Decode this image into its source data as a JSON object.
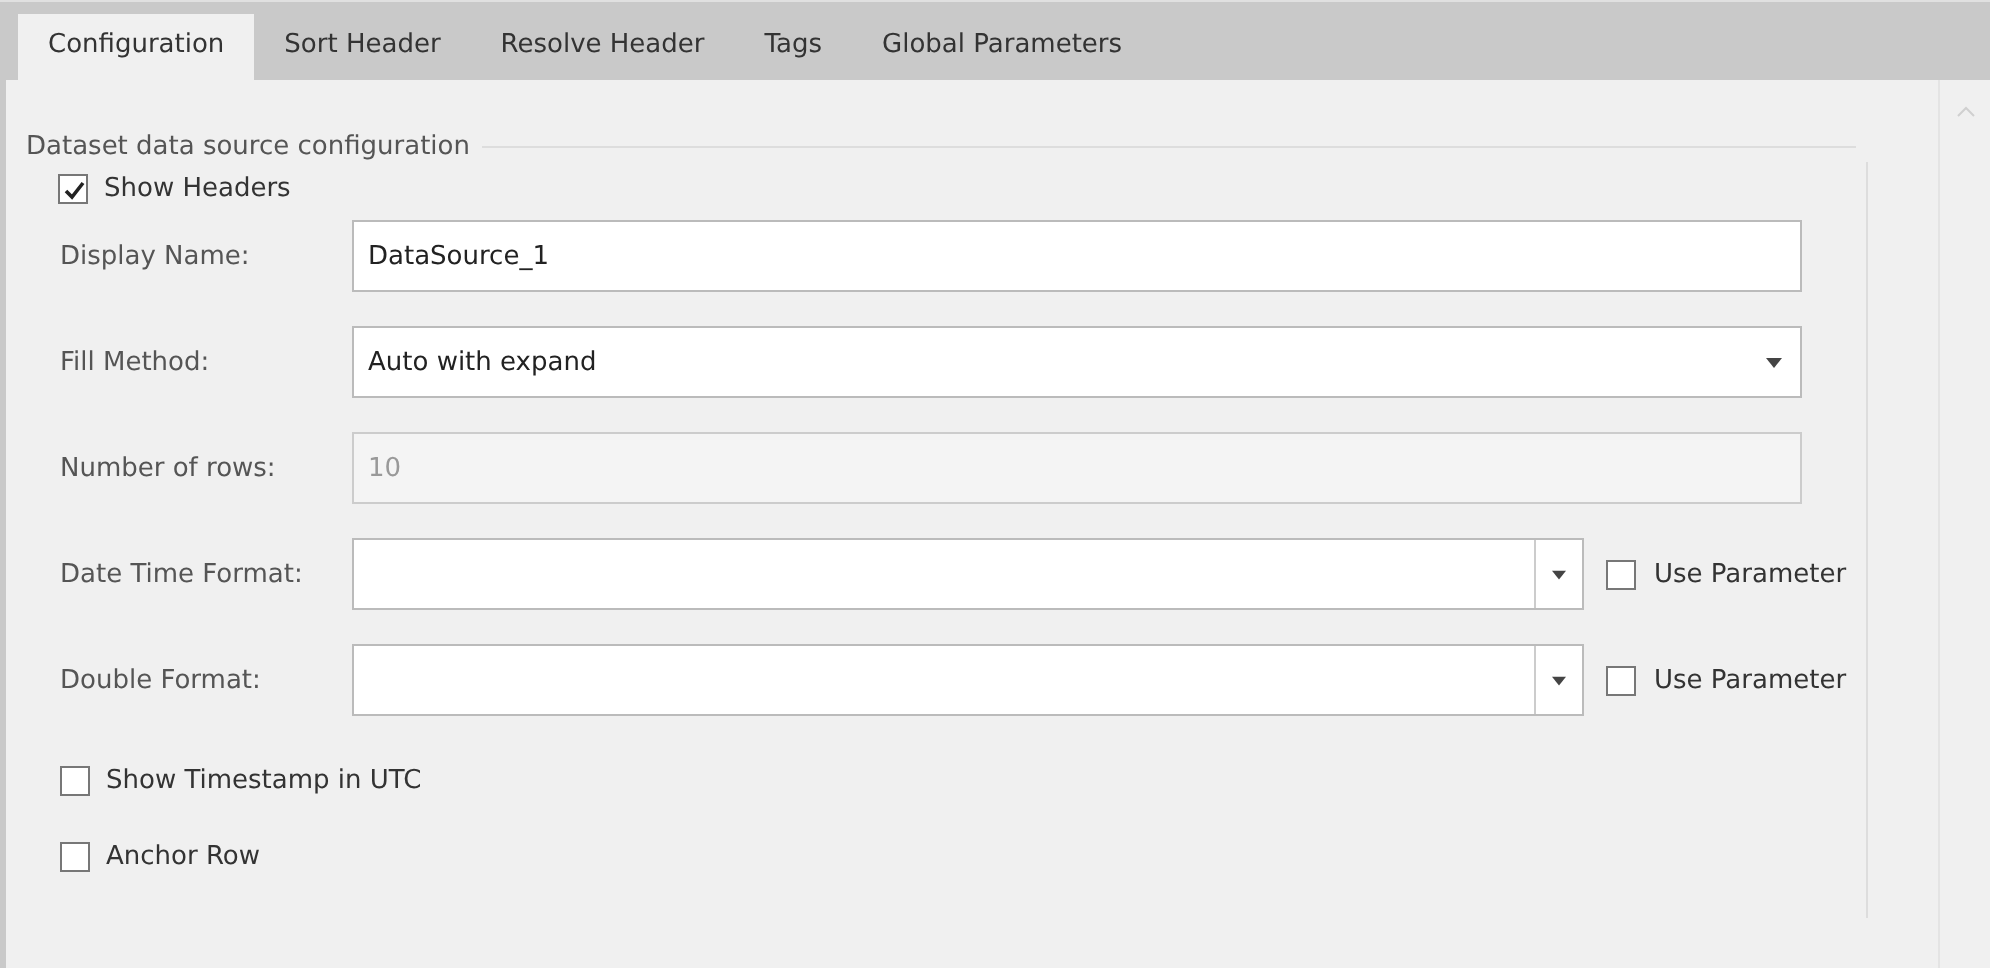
{
  "tabs": [
    {
      "label": "Configuration",
      "selected": true
    },
    {
      "label": "Sort Header",
      "selected": false
    },
    {
      "label": "Resolve Header",
      "selected": false
    },
    {
      "label": "Tags",
      "selected": false
    },
    {
      "label": "Global Parameters",
      "selected": false
    }
  ],
  "group": {
    "title": "Dataset data source configuration",
    "show_headers": {
      "label": "Show Headers",
      "checked": true
    },
    "fields": [
      {
        "kind": "text",
        "label": "Display Name:",
        "value": "DataSource_1",
        "disabled": false
      },
      {
        "kind": "dropdown",
        "label": "Fill Method:",
        "value": "Auto with expand",
        "disabled": false
      },
      {
        "kind": "text",
        "label": "Number of rows:",
        "value": "10",
        "disabled": true
      },
      {
        "kind": "combo",
        "label": "Date Time Format:",
        "disabled": false,
        "use_parameter": {
          "label": "Use Parameter",
          "checked": false
        }
      },
      {
        "kind": "combo",
        "label": "Double Format:",
        "disabled": false,
        "use_parameter": {
          "label": "Use Parameter",
          "checked": false
        }
      }
    ],
    "options": [
      {
        "label": "Show Timestamp in UTC",
        "checked": false
      },
      {
        "label": "Anchor Row",
        "checked": false
      }
    ]
  }
}
